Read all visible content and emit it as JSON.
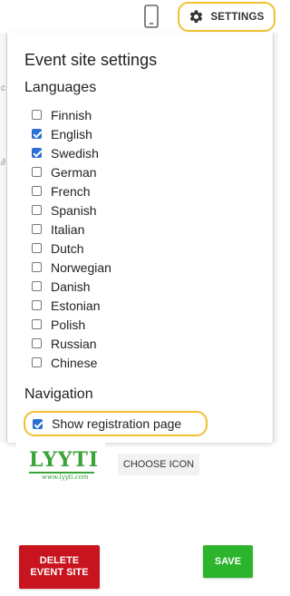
{
  "topbar": {
    "settings_label": "SETTINGS",
    "icons": [
      "mobile-phone-icon",
      "gear-icon"
    ],
    "highlight_color": "#f0c030"
  },
  "panel": {
    "title": "Event site settings",
    "languages_heading": "Languages",
    "languages": [
      {
        "label": "Finnish",
        "checked": false
      },
      {
        "label": "English",
        "checked": true
      },
      {
        "label": "Swedish",
        "checked": true
      },
      {
        "label": "German",
        "checked": false
      },
      {
        "label": "French",
        "checked": false
      },
      {
        "label": "Spanish",
        "checked": false
      },
      {
        "label": "Italian",
        "checked": false
      },
      {
        "label": "Dutch",
        "checked": false
      },
      {
        "label": "Norwegian",
        "checked": false
      },
      {
        "label": "Danish",
        "checked": false
      },
      {
        "label": "Estonian",
        "checked": false
      },
      {
        "label": "Polish",
        "checked": false
      },
      {
        "label": "Russian",
        "checked": false
      },
      {
        "label": "Chinese",
        "checked": false
      }
    ],
    "navigation_heading": "Navigation",
    "show_registration": {
      "label": "Show registration page",
      "checked": true
    }
  },
  "logo": {
    "text": "LYYTI",
    "tagline": "www.lyyti.com"
  },
  "actions": {
    "choose_icon_label": "CHOOSE ICON",
    "delete_label_line1": "DELETE",
    "delete_label_line2": "EVENT SITE",
    "save_label": "SAVE",
    "delete_color": "#c8141e",
    "save_color": "#2cb52c"
  }
}
